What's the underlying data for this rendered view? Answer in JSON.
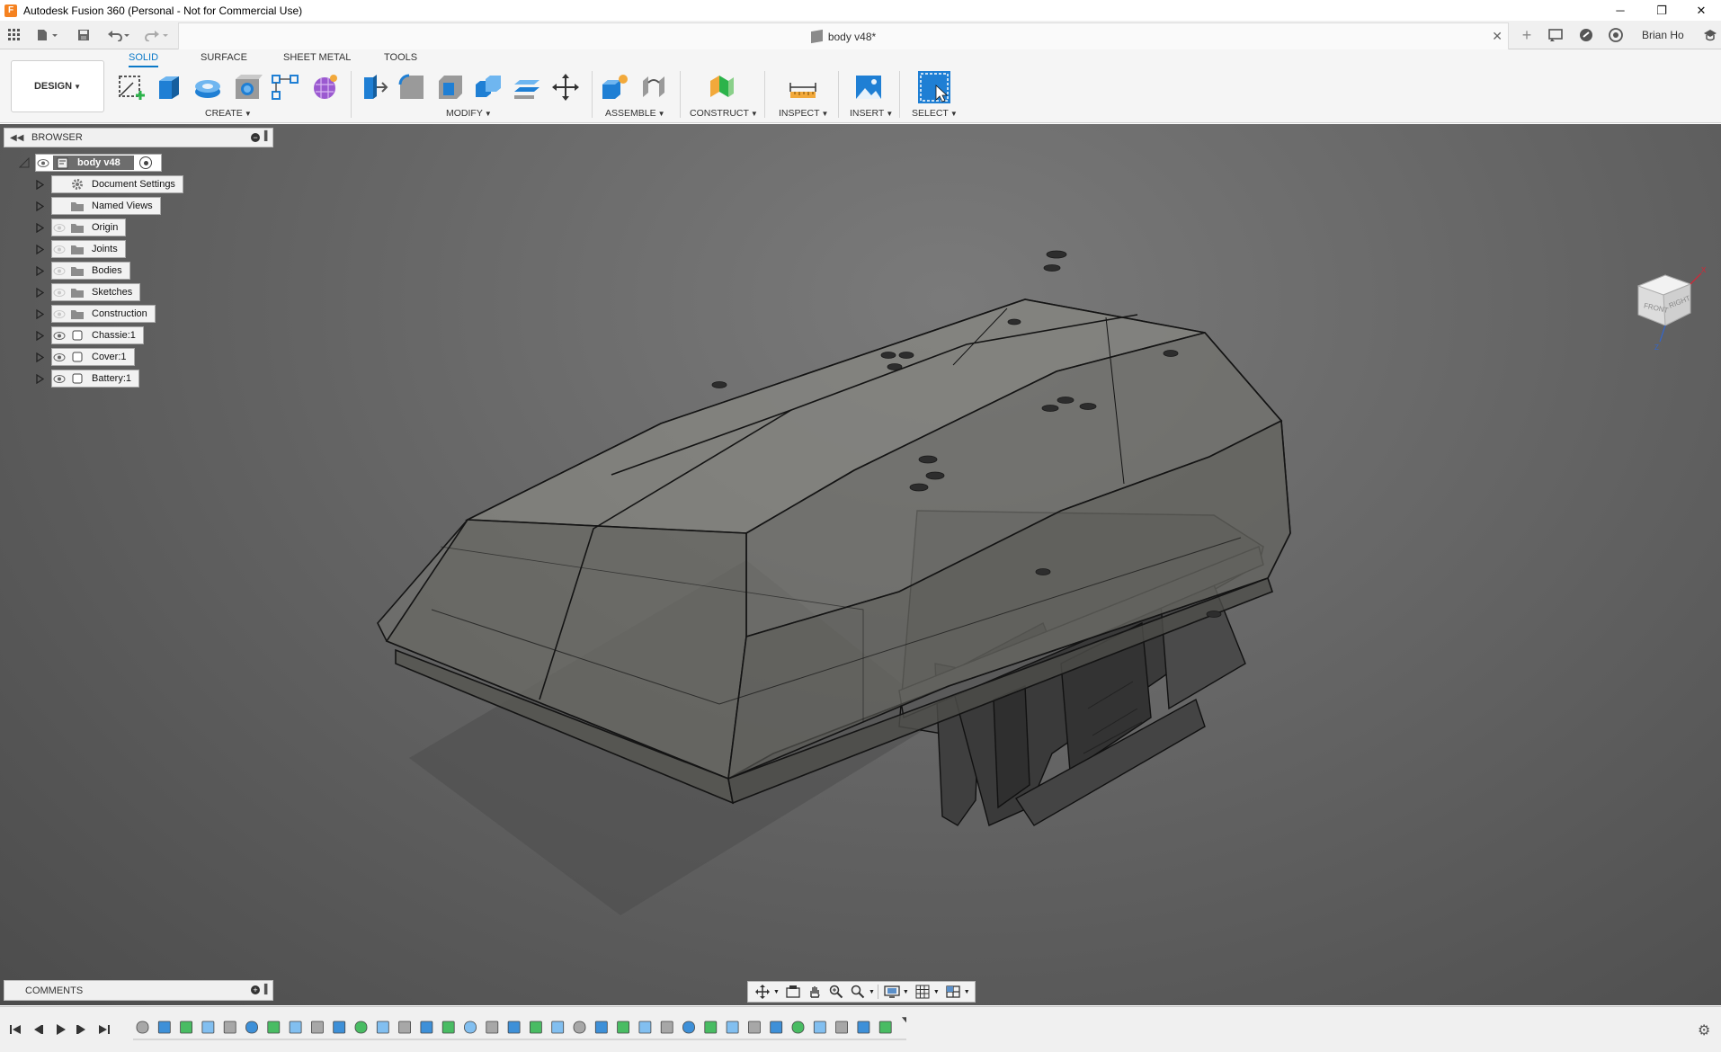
{
  "window": {
    "title": "Autodesk Fusion 360 (Personal - Not for Commercial Use)",
    "logo_letter": "F",
    "minimize": "─",
    "restore": "❐",
    "close": "✕"
  },
  "tabbar": {
    "document_tab": "body v48*",
    "tab_close": "✕",
    "new_tab": "+",
    "user": "Brian Ho"
  },
  "ribbon": {
    "workspace": "DESIGN",
    "tabs": [
      "SOLID",
      "SURFACE",
      "SHEET METAL",
      "TOOLS"
    ],
    "groups": {
      "create": "CREATE",
      "modify": "MODIFY",
      "assemble": "ASSEMBLE",
      "construct": "CONSTRUCT",
      "inspect": "INSPECT",
      "insert": "INSERT",
      "select": "SELECT"
    }
  },
  "browser": {
    "title": "BROWSER",
    "root": "body v48",
    "nodes": [
      {
        "label": "Document Settings",
        "icon": "gear-icon",
        "eye": false
      },
      {
        "label": "Named Views",
        "icon": "folder-icon",
        "eye": false
      },
      {
        "label": "Origin",
        "icon": "folder-icon",
        "eye": true
      },
      {
        "label": "Joints",
        "icon": "folder-icon",
        "eye": true
      },
      {
        "label": "Bodies",
        "icon": "folder-icon",
        "eye": true
      },
      {
        "label": "Sketches",
        "icon": "folder-icon",
        "eye": true
      },
      {
        "label": "Construction",
        "icon": "folder-icon",
        "eye": true
      },
      {
        "label": "Chassie:1",
        "icon": "component-icon",
        "eye": true
      },
      {
        "label": "Cover:1",
        "icon": "component-icon",
        "eye": true
      },
      {
        "label": "Battery:1",
        "icon": "component-icon",
        "eye": true
      }
    ]
  },
  "comments": {
    "title": "COMMENTS"
  },
  "viewcube": {
    "front": "FRONT",
    "right": "RIGHT",
    "axis_x": "X",
    "axis_z": "Z"
  },
  "colors": {
    "accent": "#0b79c8",
    "viewport_bg": "#666666"
  }
}
